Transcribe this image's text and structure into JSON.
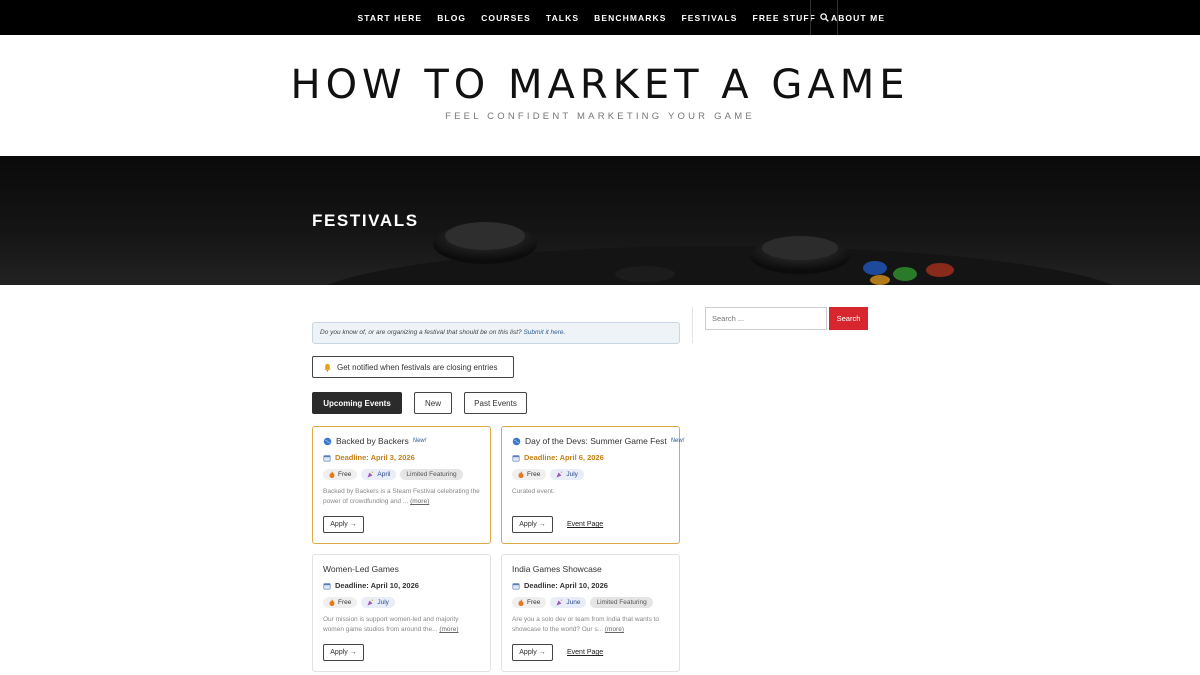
{
  "nav": {
    "items": [
      "START HERE",
      "BLOG",
      "COURSES",
      "TALKS",
      "BENCHMARKS",
      "FESTIVALS",
      "FREE STUFF",
      "ABOUT ME"
    ],
    "search_icon": "search-icon"
  },
  "site": {
    "title": "HOW TO MARKET A GAME",
    "tagline": "FEEL CONFIDENT MARKETING YOUR GAME"
  },
  "hero": {
    "title": "FESTIVALS"
  },
  "notice": {
    "text": "Do you know of, or are organizing a festival that should be on this list?",
    "link": "Submit it here."
  },
  "notify_button": {
    "icon": "bell-icon",
    "label": "Get notified when festivals are closing entries"
  },
  "tabs": [
    {
      "label": "Upcoming Events",
      "active": true
    },
    {
      "label": "New",
      "active": false
    },
    {
      "label": "Past Events",
      "active": false
    }
  ],
  "cards": [
    {
      "name": "Backed by Backers",
      "new_badge": "New!",
      "deadline": "Deadline: April 3, 2026",
      "free": "Free",
      "month": "April",
      "limited": "Limited Featuring",
      "desc": "Backed by Backers is a Steam Festival celebrating the power of crowdfunding and ...",
      "more": "(more)",
      "apply": "Apply →",
      "event_page": ""
    },
    {
      "name": "Day of the Devs: Summer Game Fest",
      "new_badge": "New!",
      "deadline": "Deadline: April 6, 2026",
      "free": "Free",
      "month": "July",
      "limited": "",
      "desc": "Curated event.",
      "more": "",
      "apply": "Apply →",
      "event_page": "Event Page"
    },
    {
      "name": "Women-Led Games",
      "new_badge": "",
      "deadline": "Deadline: April 10, 2026",
      "free": "Free",
      "month": "July",
      "limited": "",
      "desc": "Our mission is support women-led and majority women game studios from around the...",
      "more": "(more)",
      "apply": "Apply →",
      "event_page": ""
    },
    {
      "name": "India Games Showcase",
      "new_badge": "",
      "deadline": "Deadline: April 10, 2026",
      "free": "Free",
      "month": "June",
      "limited": "Limited Featuring",
      "desc": "Are you a solo dev or team from India that wants to showcase to the world? Our s...",
      "more": "(more)",
      "apply": "Apply →",
      "event_page": "Event Page"
    }
  ],
  "sidebar": {
    "search_placeholder": "Search ...",
    "search_button": "Search"
  },
  "colors": {
    "accent_red": "#d8262e",
    "featured_border": "#e1a84a",
    "deadline_hot": "#c58019"
  }
}
